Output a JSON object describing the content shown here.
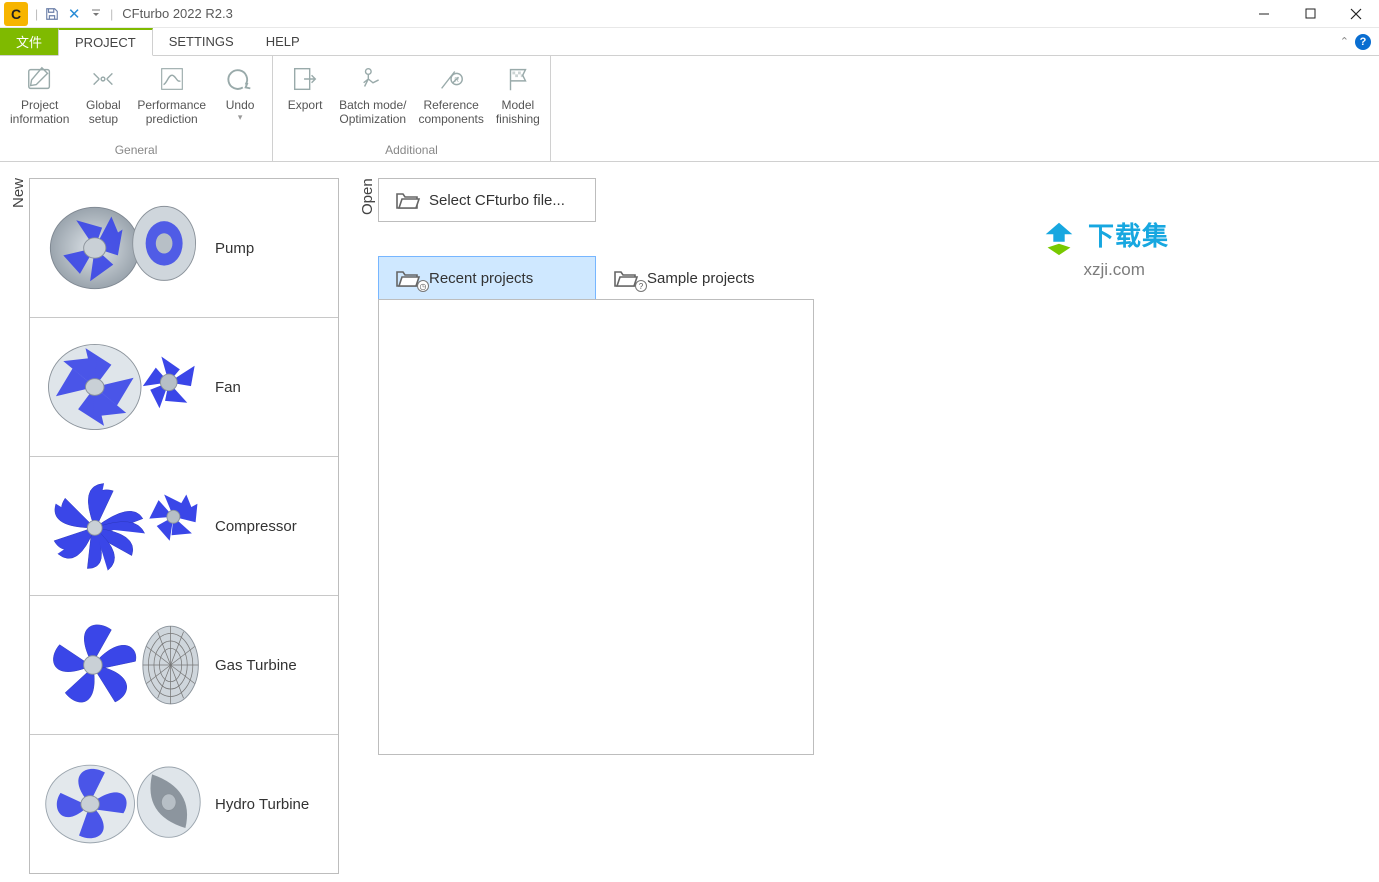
{
  "titlebar": {
    "app_title": "CFturbo 2022 R2.3"
  },
  "ribbon_tabs": {
    "file": "文件",
    "project": "PROJECT",
    "settings": "SETTINGS",
    "help": "HELP"
  },
  "ribbon": {
    "groups": {
      "general": {
        "label": "General",
        "items": {
          "project_info": "Project\ninformation",
          "global_setup": "Global\nsetup",
          "perf_predict": "Performance\nprediction",
          "undo": "Undo"
        }
      },
      "additional": {
        "label": "Additional",
        "items": {
          "export": "Export",
          "batch": "Batch mode/\nOptimization",
          "ref_comp": "Reference\ncomponents",
          "model_finish": "Model\nfinishing"
        }
      }
    }
  },
  "side_labels": {
    "new": "New",
    "open": "Open"
  },
  "new_items": {
    "pump": "Pump",
    "fan": "Fan",
    "compressor": "Compressor",
    "gas_turbine": "Gas Turbine",
    "hydro_turbine": "Hydro Turbine"
  },
  "open_panel": {
    "select_file": "Select CFturbo file...",
    "recent": "Recent projects",
    "sample": "Sample projects"
  },
  "watermark": {
    "cn": "下载集",
    "en": "xzji.com"
  }
}
